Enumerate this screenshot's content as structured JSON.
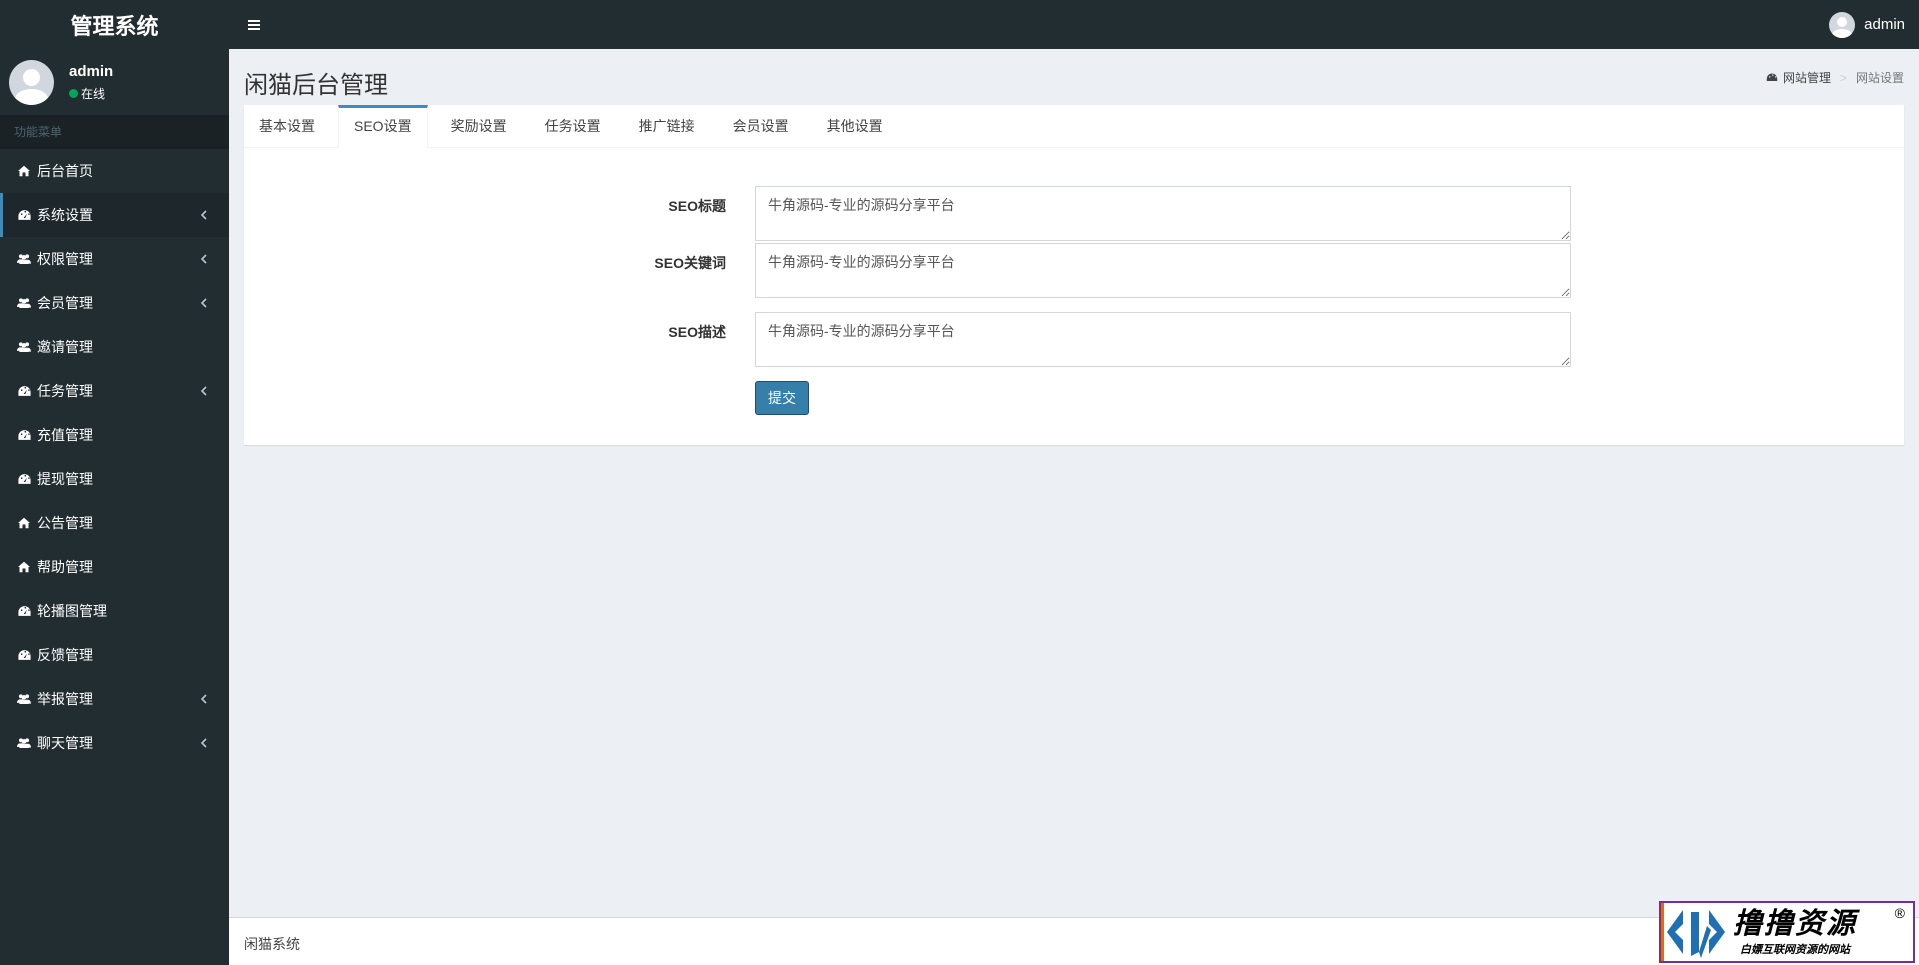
{
  "header": {
    "logo": "管理系统",
    "user_name": "admin"
  },
  "sidebar": {
    "user_name": "admin",
    "status": "在线",
    "menu_header": "功能菜单",
    "items": [
      {
        "label": "后台首页",
        "icon": "home-icon",
        "has_children": false,
        "active": false
      },
      {
        "label": "系统设置",
        "icon": "dashboard-icon",
        "has_children": true,
        "active": true
      },
      {
        "label": "权限管理",
        "icon": "users-icon",
        "has_children": true,
        "active": false
      },
      {
        "label": "会员管理",
        "icon": "users-icon",
        "has_children": true,
        "active": false
      },
      {
        "label": "邀请管理",
        "icon": "users-icon",
        "has_children": false,
        "active": false
      },
      {
        "label": "任务管理",
        "icon": "dashboard-icon",
        "has_children": true,
        "active": false
      },
      {
        "label": "充值管理",
        "icon": "dashboard-icon",
        "has_children": false,
        "active": false
      },
      {
        "label": "提现管理",
        "icon": "dashboard-icon",
        "has_children": false,
        "active": false
      },
      {
        "label": "公告管理",
        "icon": "home-icon",
        "has_children": false,
        "active": false
      },
      {
        "label": "帮助管理",
        "icon": "home-icon",
        "has_children": false,
        "active": false
      },
      {
        "label": "轮播图管理",
        "icon": "dashboard-icon",
        "has_children": false,
        "active": false
      },
      {
        "label": "反馈管理",
        "icon": "dashboard-icon",
        "has_children": false,
        "active": false
      },
      {
        "label": "举报管理",
        "icon": "users-icon",
        "has_children": true,
        "active": false
      },
      {
        "label": "聊天管理",
        "icon": "users-icon",
        "has_children": true,
        "active": false
      }
    ]
  },
  "page": {
    "title": "闲猫后台管理",
    "breadcrumb": [
      "网站管理",
      "网站设置"
    ]
  },
  "tabs": [
    "基本设置",
    "SEO设置",
    "奖励设置",
    "任务设置",
    "推广链接",
    "会员设置",
    "其他设置"
  ],
  "active_tab": "SEO设置",
  "form": {
    "fields": [
      {
        "label": "SEO标题",
        "value": "牛角源码-专业的源码分享平台"
      },
      {
        "label": "SEO关键词",
        "value": "牛角源码-专业的源码分享平台"
      },
      {
        "label": "SEO描述",
        "value": "牛角源码-专业的源码分享平台"
      }
    ],
    "submit_label": "提交"
  },
  "footer": {
    "text": "闲猫系统"
  },
  "watermark": {
    "title": "撸撸资源",
    "subtitle": "白嫖互联网资源的网站",
    "reg": "®"
  },
  "colors": {
    "sidebar_bg": "#222d32",
    "accent": "#3c8dbc",
    "button": "#367fa9",
    "online": "#00a65a"
  }
}
